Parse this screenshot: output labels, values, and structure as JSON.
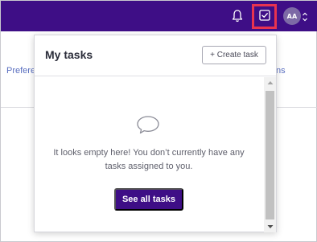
{
  "topbar": {
    "avatar_initials": "AA",
    "accent_color": "#3e0e86",
    "highlight_color": "#e8334f"
  },
  "background": {
    "left_link": "Prefere",
    "right_link": "ns"
  },
  "dropdown": {
    "title": "My tasks",
    "create_button": "+ Create task",
    "empty_message": "It looks empty here! You don’t currently have any tasks assigned to you.",
    "see_all_button": "See all tasks"
  },
  "icons": {
    "bell": "bell-icon",
    "tasks": "checkbox-icon",
    "empty": "speech-bubble-icon"
  }
}
